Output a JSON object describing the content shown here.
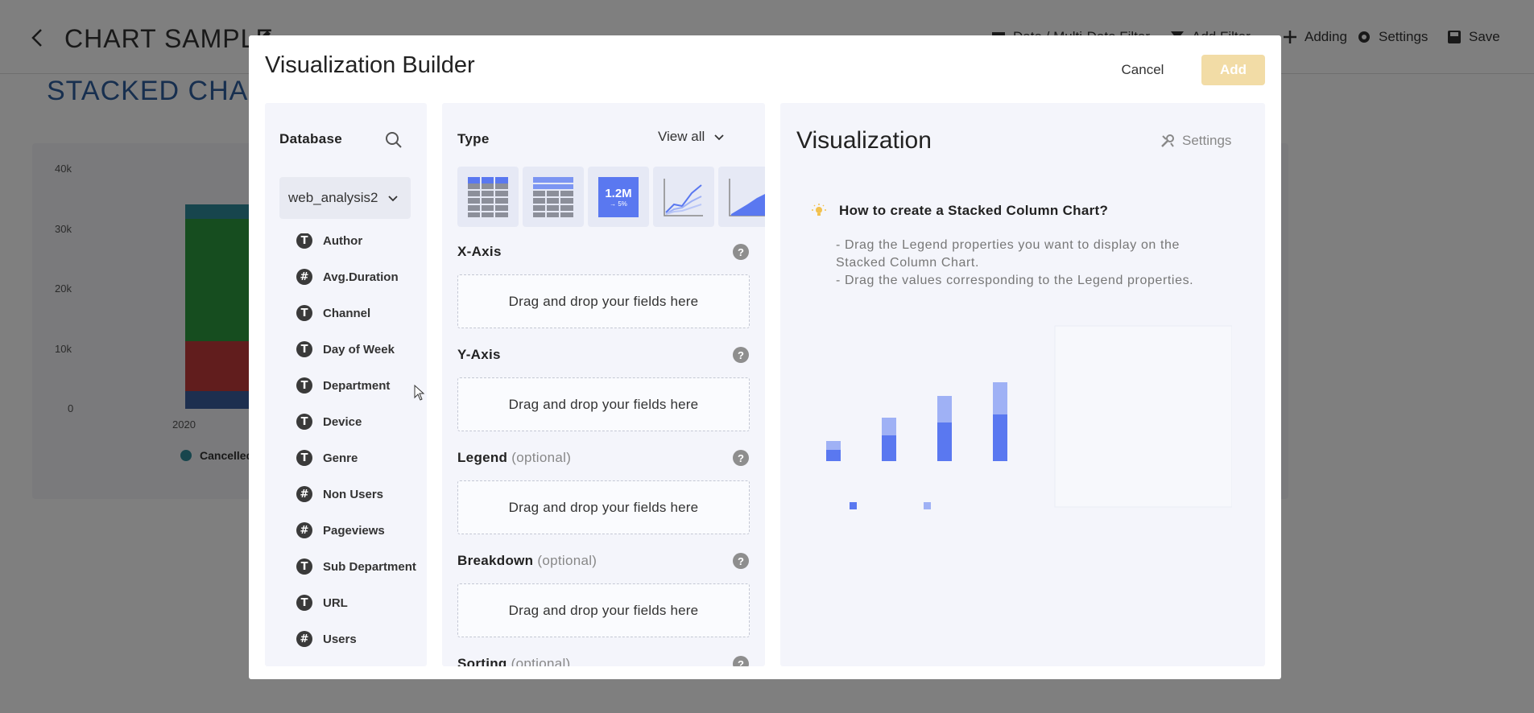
{
  "background": {
    "page_title": "CHART SAMPLE",
    "toolbar": {
      "date_filter": "Date / Multi-Date Filter",
      "add_filter": "Add Filter",
      "adding": "Adding",
      "settings": "Settings",
      "save": "Save"
    },
    "chart_title": "STACKED CHART",
    "y_ticks": [
      "40k",
      "30k",
      "20k",
      "10k",
      "0"
    ],
    "x_ticks": [
      "2020"
    ],
    "legend_item": "Cancelled"
  },
  "modal": {
    "title": "Visualization Builder",
    "cancel_label": "Cancel",
    "add_label": "Add",
    "database": {
      "label": "Database",
      "selected": "web_analysis2",
      "fields": [
        {
          "type": "T",
          "name": "Author"
        },
        {
          "type": "#",
          "name": "Avg.Duration"
        },
        {
          "type": "T",
          "name": "Channel"
        },
        {
          "type": "T",
          "name": "Day of Week"
        },
        {
          "type": "T",
          "name": "Department"
        },
        {
          "type": "T",
          "name": "Device"
        },
        {
          "type": "T",
          "name": "Genre"
        },
        {
          "type": "#",
          "name": "Non Users"
        },
        {
          "type": "#",
          "name": "Pageviews"
        },
        {
          "type": "T",
          "name": "Sub Department"
        },
        {
          "type": "T",
          "name": "URL"
        },
        {
          "type": "#",
          "name": "Users"
        }
      ]
    },
    "config": {
      "type_label": "Type",
      "view_all_label": "View all",
      "kpi_tile": {
        "value": "1.2M",
        "delta": "→ 5%"
      },
      "sections": [
        {
          "label": "X-Axis",
          "optional": "",
          "dropzone": "Drag and drop your fields here"
        },
        {
          "label": "Y-Axis",
          "optional": "",
          "dropzone": "Drag and drop your fields here"
        },
        {
          "label": "Legend",
          "optional": "(optional)",
          "dropzone": "Drag and drop your fields here"
        },
        {
          "label": "Breakdown",
          "optional": "(optional)",
          "dropzone": "Drag and drop your fields here"
        },
        {
          "label": "Sorting",
          "optional": "(optional)",
          "dropzone": ""
        }
      ]
    },
    "visualization": {
      "title": "Visualization",
      "settings_label": "Settings",
      "howto_title": "How to create a Stacked Column Chart?",
      "howto_lines": [
        "- Drag the Legend properties you want to display on the",
        "Stacked Column Chart.",
        "- Drag the values corresponding to the Legend properties."
      ]
    },
    "colors": {
      "accent": "#5a78f0",
      "accent_light": "#9fb1f5",
      "add_button": "#f2dca6",
      "panel_bg": "#f4f5fb"
    }
  }
}
